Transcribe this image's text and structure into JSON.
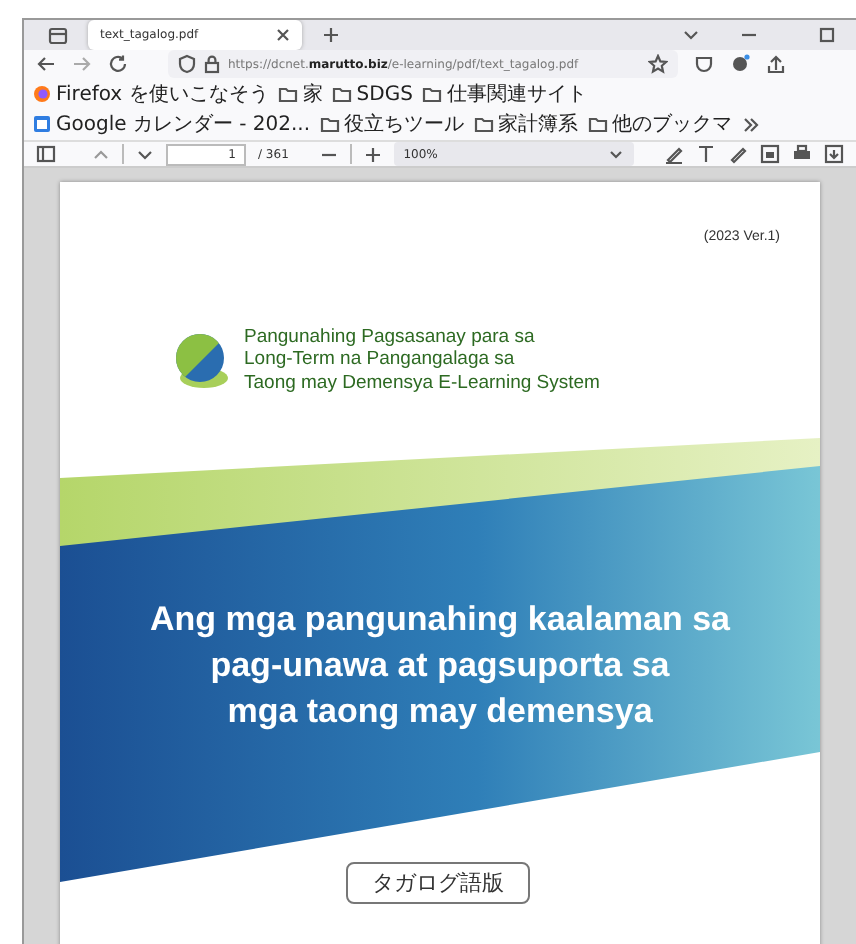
{
  "tabs": [
    {
      "title": "text_tagalog.pdf",
      "selected": true
    }
  ],
  "address_bar": {
    "url": "https://dcnet.**marutto.biz**/e-learning/pdf/text_tagalog.pdf"
  },
  "bookmarks": [
    {
      "label": "Firefox を使いこなそう",
      "kind": "firefox"
    },
    {
      "label": "家",
      "kind": "folder"
    },
    {
      "label": "SDGS",
      "kind": "folder"
    },
    {
      "label": "仕事関連サイト",
      "kind": "folder"
    },
    {
      "label": "Google カレンダー - 202...",
      "kind": "calendar"
    },
    {
      "label": "役立ちツール",
      "kind": "folder"
    },
    {
      "label": "家計簿系",
      "kind": "folder"
    },
    {
      "label": "他のブックマ",
      "kind": "folder"
    }
  ],
  "pdf_toolbar": {
    "page": "1",
    "page_count": "/ 361",
    "zoom": "100%"
  },
  "document": {
    "version": "(2023 Ver.1)",
    "program_title": "Pangunahing Pagsasanay para sa\nLong-Term na Pangangalaga sa\nTaong may Demensya E-Learning System",
    "main_title": "Ang mga pangunahing kaalaman sa\npag-unawa at pagsuporta sa\nmga taong may demensya",
    "edition_label": "タガログ語版"
  }
}
